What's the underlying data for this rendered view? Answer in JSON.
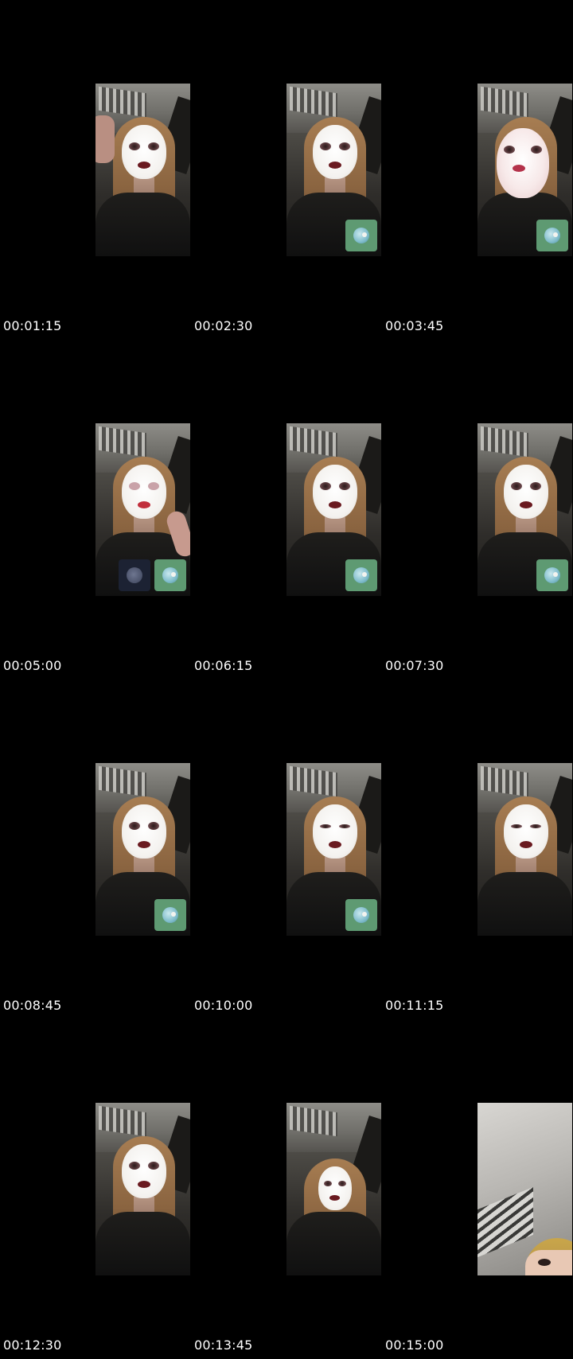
{
  "frames": [
    {
      "timestamp": "00:01:15",
      "variant": "hand",
      "overlays": []
    },
    {
      "timestamp": "00:02:30",
      "variant": "standard",
      "overlays": [
        "avatar"
      ]
    },
    {
      "timestamp": "00:03:45",
      "variant": "closeup",
      "overlays": [
        "avatar"
      ]
    },
    {
      "timestamp": "00:05:00",
      "variant": "wave",
      "overlays": [
        "dark-avatar",
        "avatar"
      ]
    },
    {
      "timestamp": "00:06:15",
      "variant": "standard",
      "overlays": [
        "avatar"
      ]
    },
    {
      "timestamp": "00:07:30",
      "variant": "standard",
      "overlays": [
        "avatar"
      ]
    },
    {
      "timestamp": "00:08:45",
      "variant": "standard",
      "overlays": [
        "avatar"
      ]
    },
    {
      "timestamp": "00:10:00",
      "variant": "standard",
      "overlays": [
        "avatar"
      ]
    },
    {
      "timestamp": "00:11:15",
      "variant": "standard",
      "overlays": []
    },
    {
      "timestamp": "00:12:30",
      "variant": "standard",
      "overlays": []
    },
    {
      "timestamp": "00:13:45",
      "variant": "lowface",
      "overlays": []
    },
    {
      "timestamp": "00:15:00",
      "variant": "selfie",
      "overlays": []
    }
  ]
}
